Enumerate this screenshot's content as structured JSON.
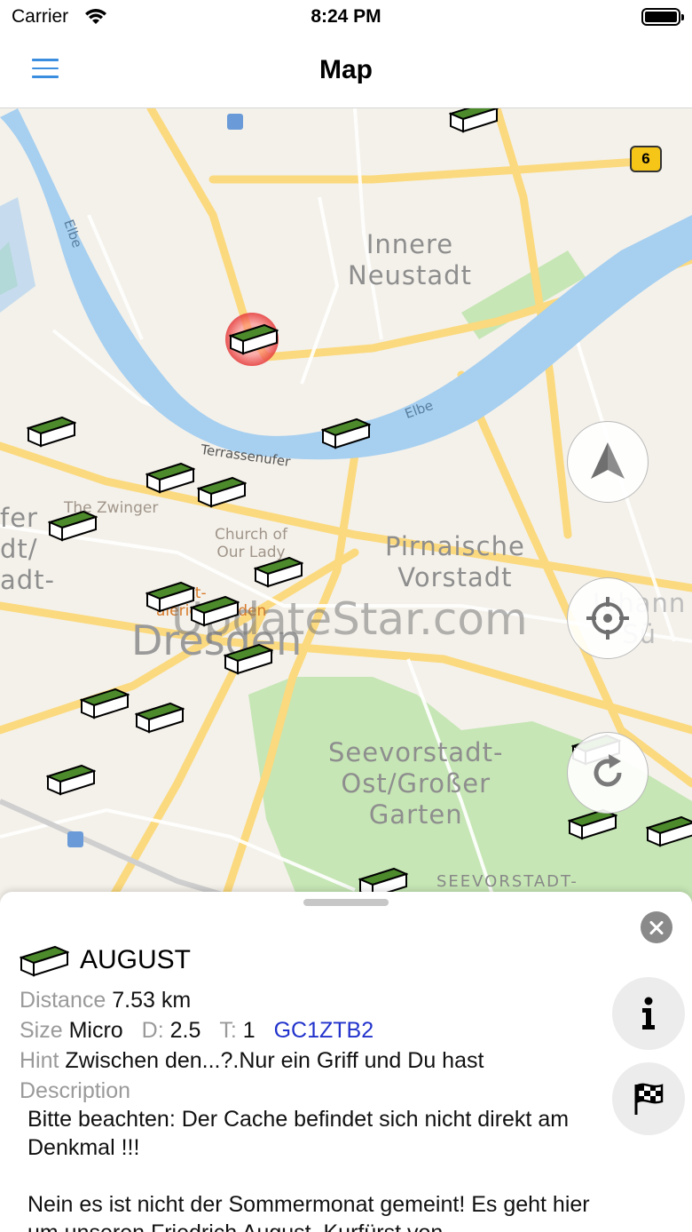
{
  "status_bar": {
    "carrier": "Carrier",
    "time": "8:24 PM"
  },
  "nav": {
    "title": "Map"
  },
  "map": {
    "districts": {
      "innere_neustadt": "Innere\nNeustadt",
      "pirnaische_vorstadt": "Pirnaische\nVorstadt",
      "seevorstadt_ost": "Seevorstadt-\nOst/Großer\nGarten",
      "seevorstadt_bottom": "SEEVORSTADT-",
      "johann_partial": "Johann\nSü",
      "left_partial": "fer\ndt/\nadt-",
      "dresden": "Dresden"
    },
    "pois": {
      "zwinger": "The Zwinger",
      "church": "Church of\nOur Lady",
      "altmarkt": "markt-\nalerie Dresden"
    },
    "streets": {
      "terrassenufer": "Terrassenufer",
      "elbe_1": "Elbe",
      "elbe_2": "Elbe"
    },
    "road_badge": "6",
    "watermark": "UpdateStar.com"
  },
  "cache": {
    "name": "AUGUST",
    "distance_label": "Distance",
    "distance_value": "7.53 km",
    "size_label": "Size",
    "size_value": "Micro",
    "difficulty_label": "D:",
    "difficulty_value": "2.5",
    "terrain_label": "T:",
    "terrain_value": "1",
    "code": "GC1ZTB2",
    "hint_label": "Hint",
    "hint_value": "Zwischen den...?.Nur ein Griff und Du hast",
    "description_label": "Description",
    "description_p1": "Bitte beachten: Der Cache befindet sich nicht direkt am Denkmal !!!",
    "description_p2": "Nein es ist nicht der Sommermonat gemeint! Es geht hier um unseren Friedrich August, Kurfürst von"
  },
  "icons": {
    "menu": "menu-icon",
    "compass": "compass-arrow-icon",
    "locate": "crosshair-icon",
    "refresh": "refresh-icon",
    "close": "close-icon",
    "info": "info-icon",
    "finish": "checkered-flag-icon",
    "cache": "cache-box-icon"
  },
  "colors": {
    "accent": "#3b8de0",
    "river": "#a6cff0",
    "park": "#c6e6b5",
    "road": "#fbd97e",
    "code_link": "#2233cc",
    "marker_green": "#4c8a2c"
  }
}
